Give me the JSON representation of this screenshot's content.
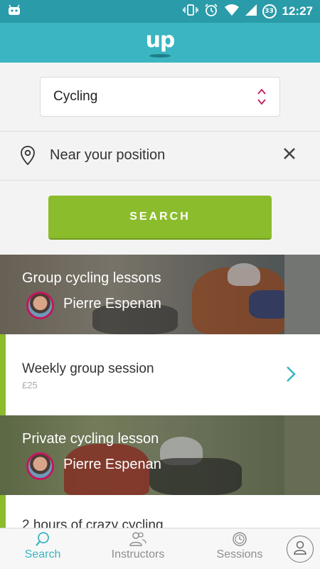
{
  "statusbar": {
    "time": "12:27",
    "battery_level": "33"
  },
  "app": {
    "logo": "up"
  },
  "filters": {
    "sport": "Cycling",
    "location": "Near your position",
    "search_label": "SEARCH"
  },
  "results": [
    {
      "title": "Group cycling lessons",
      "instructor": "Pierre Espenan",
      "sessions": [
        {
          "title": "Weekly group session",
          "price": "£25"
        }
      ]
    },
    {
      "title": "Private cycling lesson",
      "instructor": "Pierre Espenan",
      "sessions": [
        {
          "title": "2 hours of crazy cycling"
        }
      ]
    }
  ],
  "nav": {
    "search": "Search",
    "instructors": "Instructors",
    "sessions": "Sessions"
  },
  "colors": {
    "header": "#3ab5c1",
    "statusbar": "#2a9ba8",
    "accent_green": "#8bbc2b",
    "accent_pink": "#c2185b",
    "nav_active": "#3ab5c1"
  },
  "icons": {
    "sport_select": "chevron-updown-icon",
    "location": "location-pin-icon",
    "clear": "close-icon",
    "session": "chevron-right-icon",
    "nav_search": "search-icon",
    "nav_instructors": "people-icon",
    "nav_sessions": "clock-icon",
    "profile": "user-icon"
  }
}
